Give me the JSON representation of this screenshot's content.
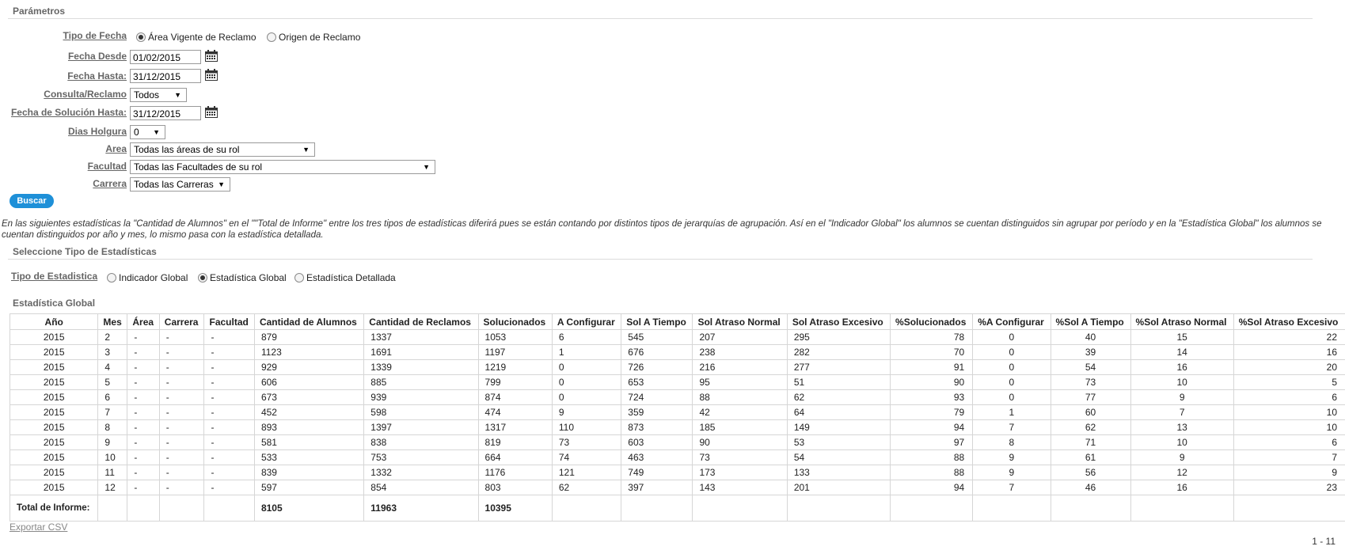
{
  "params": {
    "title": "Parámetros",
    "tipo_fecha_label": "Tipo de Fecha",
    "tipo_fecha_opt1": "Área Vigente de Reclamo",
    "tipo_fecha_opt2": "Origen de Reclamo",
    "fecha_desde_label": "Fecha Desde",
    "fecha_desde_value": "01/02/2015",
    "fecha_hasta_label": "Fecha Hasta:",
    "fecha_hasta_value": "31/12/2015",
    "consulta_label": "Consulta/Reclamo",
    "consulta_value": "Todos",
    "fecha_solucion_label": "Fecha de Solución Hasta:",
    "fecha_solucion_value": "31/12/2015",
    "dias_holgura_label": "Dias Holgura",
    "dias_holgura_value": "0",
    "area_label": "Area",
    "area_value": "Todas las áreas de su rol",
    "facultad_label": "Facultad",
    "facultad_value": "Todas las Facultades de su rol",
    "carrera_label": "Carrera",
    "carrera_value": "Todas las Carreras",
    "buscar": "Buscar"
  },
  "note": "En las siguientes estadísticas la \"Cantidad de Alumnos\" en el \"\"Total de Informe\" entre los tres tipos de estadísticas diferirá pues se están contando por distintos tipos de jerarquías de agrupación. Así en el \"Indicador Global\" los alumnos se cuentan distinguidos sin agrupar por período y en la \"Estadística Global\" los alumnos se cuentan distinguidos por año y mes, lo mismo pasa con la estadística detallada.",
  "tipo_estadistica": {
    "title": "Seleccione Tipo de Estadísticas",
    "label": "Tipo de Estadistica",
    "opt1": "Indicador Global",
    "opt2": "Estadística Global",
    "opt3": "Estadística Detallada"
  },
  "table": {
    "title": "Estadística Global",
    "headers": [
      "Año",
      "Mes",
      "Área",
      "Carrera",
      "Facultad",
      "Cantidad de Alumnos",
      "Cantidad de Reclamos",
      "Solucionados",
      "A Configurar",
      "Sol A Tiempo",
      "Sol Atraso Normal",
      "Sol Atraso Excesivo",
      "%Solucionados",
      "%A Configurar",
      "%Sol A Tiempo",
      "%Sol Atraso Normal",
      "%Sol Atraso Excesivo"
    ],
    "rows": [
      [
        "2015",
        "2",
        "-",
        "-",
        "-",
        "879",
        "1337",
        "1053",
        "6",
        "545",
        "207",
        "295",
        "78",
        "0",
        "40",
        "15",
        "22"
      ],
      [
        "2015",
        "3",
        "-",
        "-",
        "-",
        "1123",
        "1691",
        "1197",
        "1",
        "676",
        "238",
        "282",
        "70",
        "0",
        "39",
        "14",
        "16"
      ],
      [
        "2015",
        "4",
        "-",
        "-",
        "-",
        "929",
        "1339",
        "1219",
        "0",
        "726",
        "216",
        "277",
        "91",
        "0",
        "54",
        "16",
        "20"
      ],
      [
        "2015",
        "5",
        "-",
        "-",
        "-",
        "606",
        "885",
        "799",
        "0",
        "653",
        "95",
        "51",
        "90",
        "0",
        "73",
        "10",
        "5"
      ],
      [
        "2015",
        "6",
        "-",
        "-",
        "-",
        "673",
        "939",
        "874",
        "0",
        "724",
        "88",
        "62",
        "93",
        "0",
        "77",
        "9",
        "6"
      ],
      [
        "2015",
        "7",
        "-",
        "-",
        "-",
        "452",
        "598",
        "474",
        "9",
        "359",
        "42",
        "64",
        "79",
        "1",
        "60",
        "7",
        "10"
      ],
      [
        "2015",
        "8",
        "-",
        "-",
        "-",
        "893",
        "1397",
        "1317",
        "110",
        "873",
        "185",
        "149",
        "94",
        "7",
        "62",
        "13",
        "10"
      ],
      [
        "2015",
        "9",
        "-",
        "-",
        "-",
        "581",
        "838",
        "819",
        "73",
        "603",
        "90",
        "53",
        "97",
        "8",
        "71",
        "10",
        "6"
      ],
      [
        "2015",
        "10",
        "-",
        "-",
        "-",
        "533",
        "753",
        "664",
        "74",
        "463",
        "73",
        "54",
        "88",
        "9",
        "61",
        "9",
        "7"
      ],
      [
        "2015",
        "11",
        "-",
        "-",
        "-",
        "839",
        "1332",
        "1176",
        "121",
        "749",
        "173",
        "133",
        "88",
        "9",
        "56",
        "12",
        "9"
      ],
      [
        "2015",
        "12",
        "-",
        "-",
        "-",
        "597",
        "854",
        "803",
        "62",
        "397",
        "143",
        "201",
        "94",
        "7",
        "46",
        "16",
        "23"
      ]
    ],
    "total_label": "Total de Informe:",
    "total_alumnos": "8105",
    "total_reclamos": "11963",
    "total_solucionados": "10395"
  },
  "export_label": "Exportar CSV",
  "pager": "1 - 11"
}
